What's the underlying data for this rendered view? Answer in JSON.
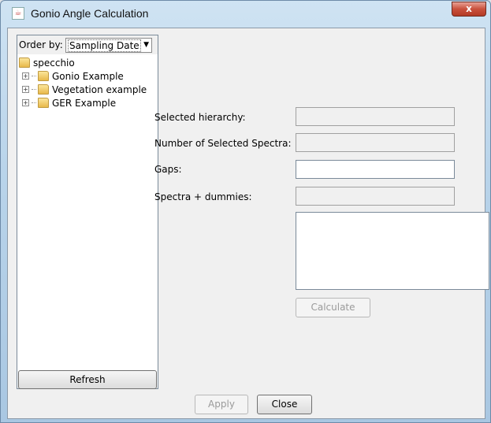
{
  "window": {
    "title": "Gonio Angle Calculation",
    "close_label": "x",
    "app_icon": "java-cup-icon"
  },
  "left_panel": {
    "order_label": "Order by:",
    "order_value": "Sampling Date",
    "tree": {
      "root": "specchio",
      "children": [
        "Gonio Example",
        "Vegetation example",
        "GER Example"
      ]
    },
    "refresh_label": "Refresh"
  },
  "form": {
    "selected_hierarchy_label": "Selected hierarchy:",
    "selected_hierarchy_value": "",
    "num_selected_label": "Number of Selected Spectra:",
    "num_selected_value": "",
    "gaps_label": "Gaps:",
    "gaps_value": "",
    "spectra_dummies_label": "Spectra + dummies:",
    "spectra_dummies_value": "",
    "calculate_label": "Calculate"
  },
  "footer": {
    "apply_label": "Apply",
    "close_label": "Close"
  }
}
